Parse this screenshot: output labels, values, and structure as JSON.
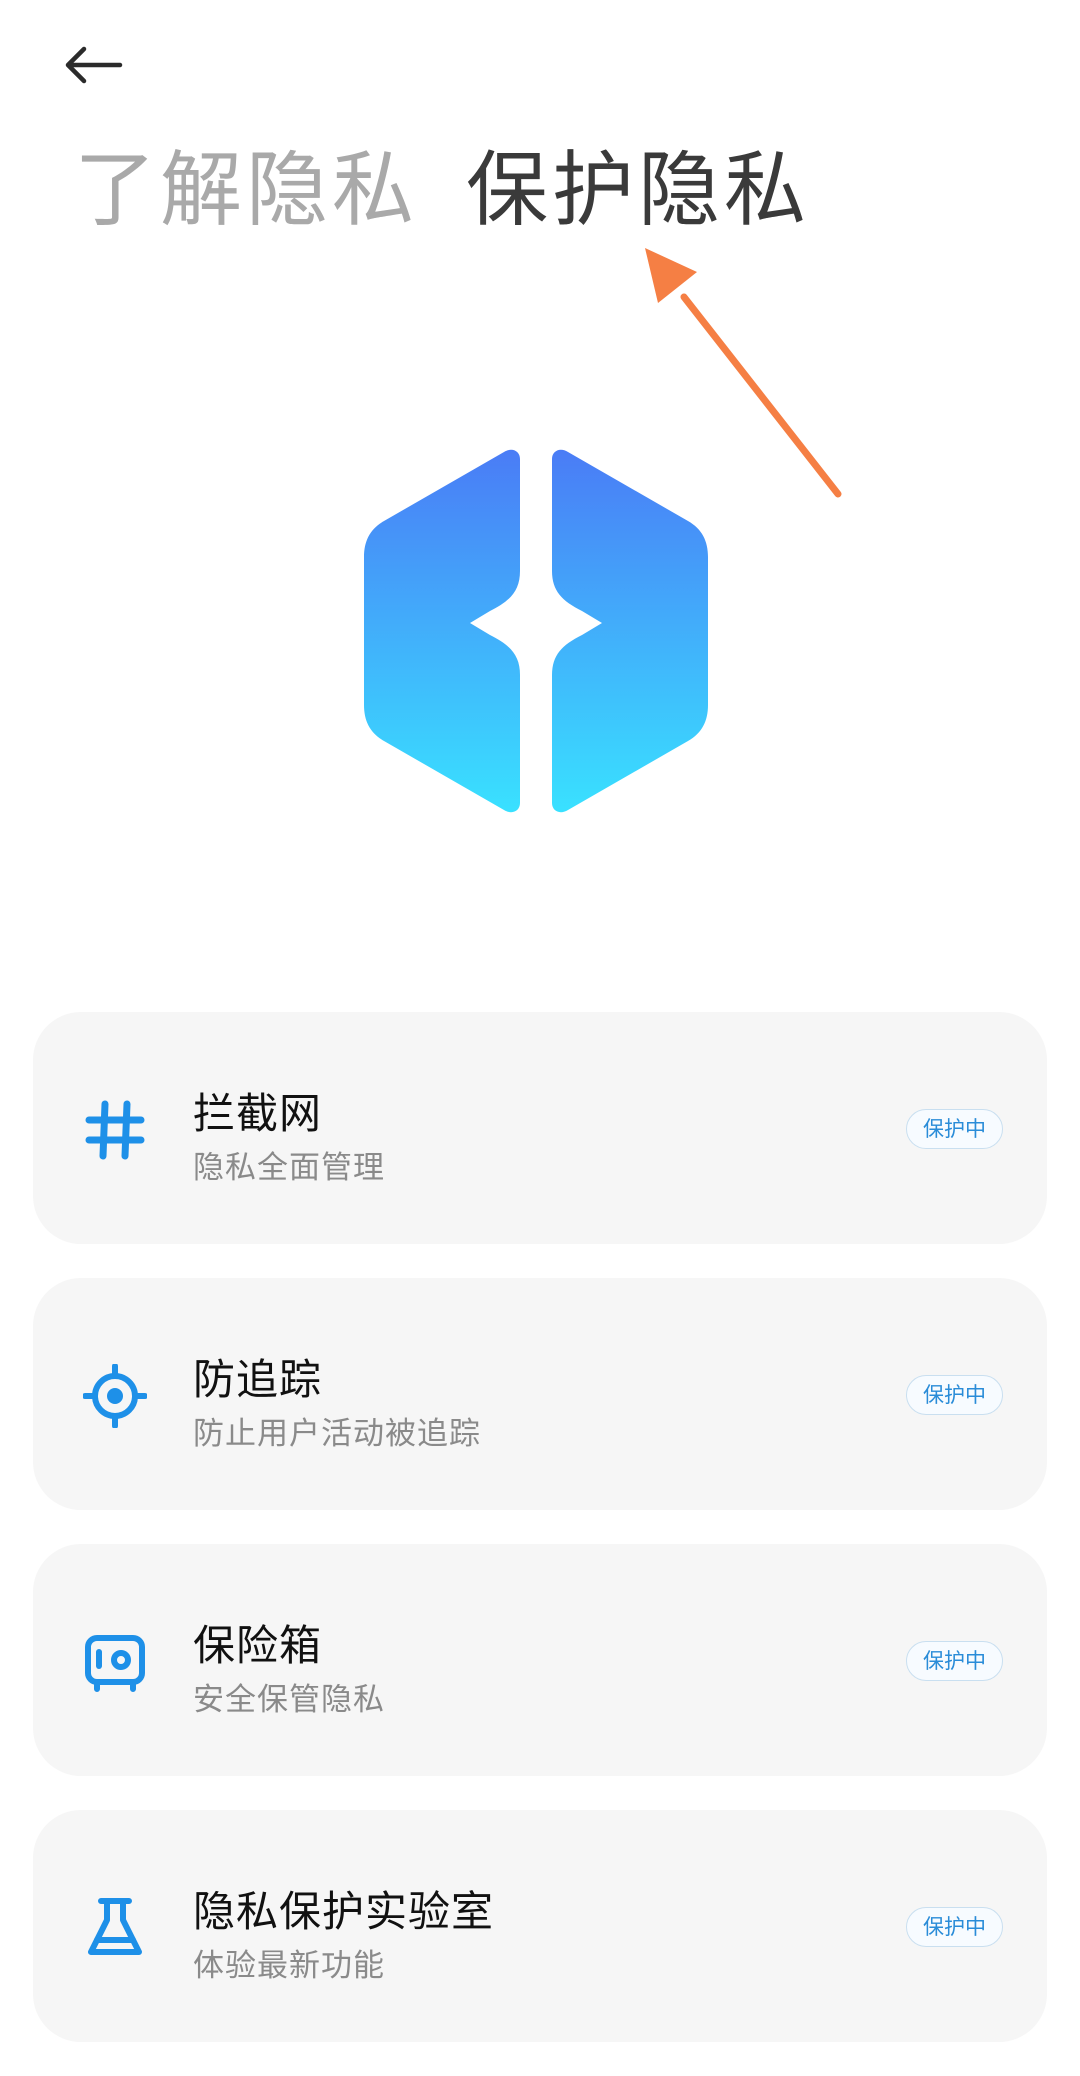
{
  "header": {
    "back_icon": "arrow-left-icon",
    "tabs": [
      {
        "label": "了解隐私",
        "active": false
      },
      {
        "label": "保护隐私",
        "active": true
      }
    ]
  },
  "logo": {
    "icon": "privacy-shield-logo"
  },
  "colors": {
    "accent": "#1E90E8",
    "annotation_arrow": "#F57F44",
    "card_bg": "#F6F6F6",
    "logo_top": "#4A7CF6",
    "logo_bottom": "#39E1FF"
  },
  "features": [
    {
      "icon": "hash-icon",
      "title": "拦截网",
      "subtitle": "隐私全面管理",
      "status": "保护中"
    },
    {
      "icon": "target-icon",
      "title": "防追踪",
      "subtitle": "防止用户活动被追踪",
      "status": "保护中"
    },
    {
      "icon": "safe-box-icon",
      "title": "保险箱",
      "subtitle": "安全保管隐私",
      "status": "保护中"
    },
    {
      "icon": "flask-icon",
      "title": "隐私保护实验室",
      "subtitle": "体验最新功能",
      "status": "保护中"
    }
  ]
}
